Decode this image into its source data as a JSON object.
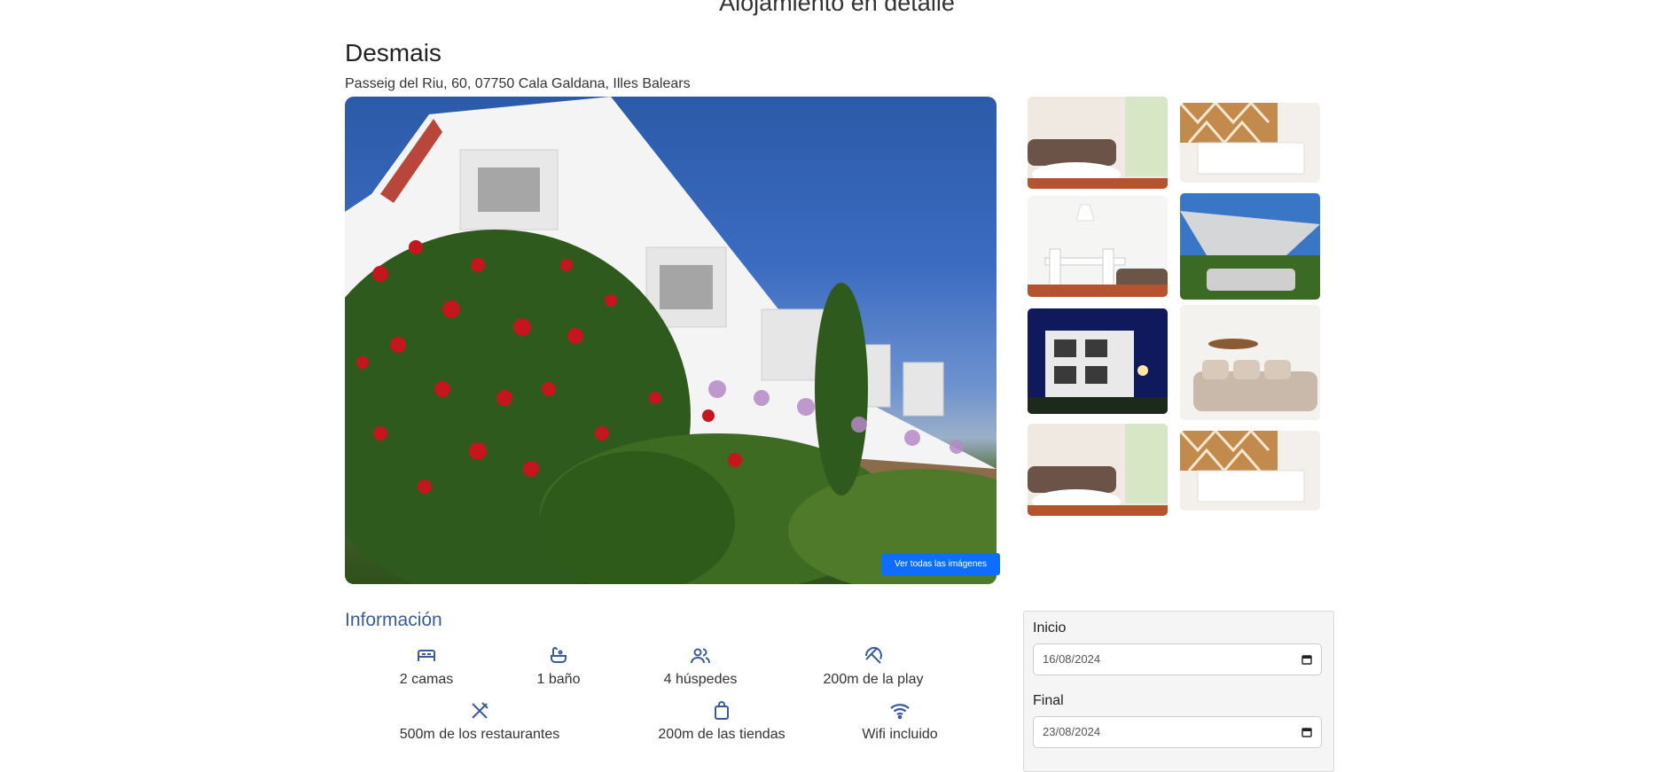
{
  "page": {
    "heading": "Alojamiento en detalle"
  },
  "property": {
    "name": "Desmais",
    "address": "Passeig del Riu, 60, 07750 Cala Galdana, Illes Balears"
  },
  "gallery": {
    "see_all_label": "Ver todas las imágenes",
    "accent": "#0d6efd"
  },
  "info": {
    "heading": "Información",
    "amenities": [
      {
        "icon": "bed-icon",
        "label": "2 camas"
      },
      {
        "icon": "bathtub-icon",
        "label": "1 baño"
      },
      {
        "icon": "guests-icon",
        "label": "4 húspedes"
      },
      {
        "icon": "beach-umbrella-icon",
        "label": "200m de la play"
      },
      {
        "icon": "restaurant-icon",
        "label": "500m de los restaurantes"
      },
      {
        "icon": "shopping-bag-icon",
        "label": "200m de las tiendas"
      },
      {
        "icon": "wifi-icon",
        "label": "Wifi incluido"
      }
    ]
  },
  "booking": {
    "start_label": "Inicio",
    "start_value": "16/08/2024",
    "end_label": "Final",
    "end_value": "23/08/2024"
  },
  "colors": {
    "heading_blue": "#3a5a9c",
    "icon_blue": "#3a5a9c"
  }
}
